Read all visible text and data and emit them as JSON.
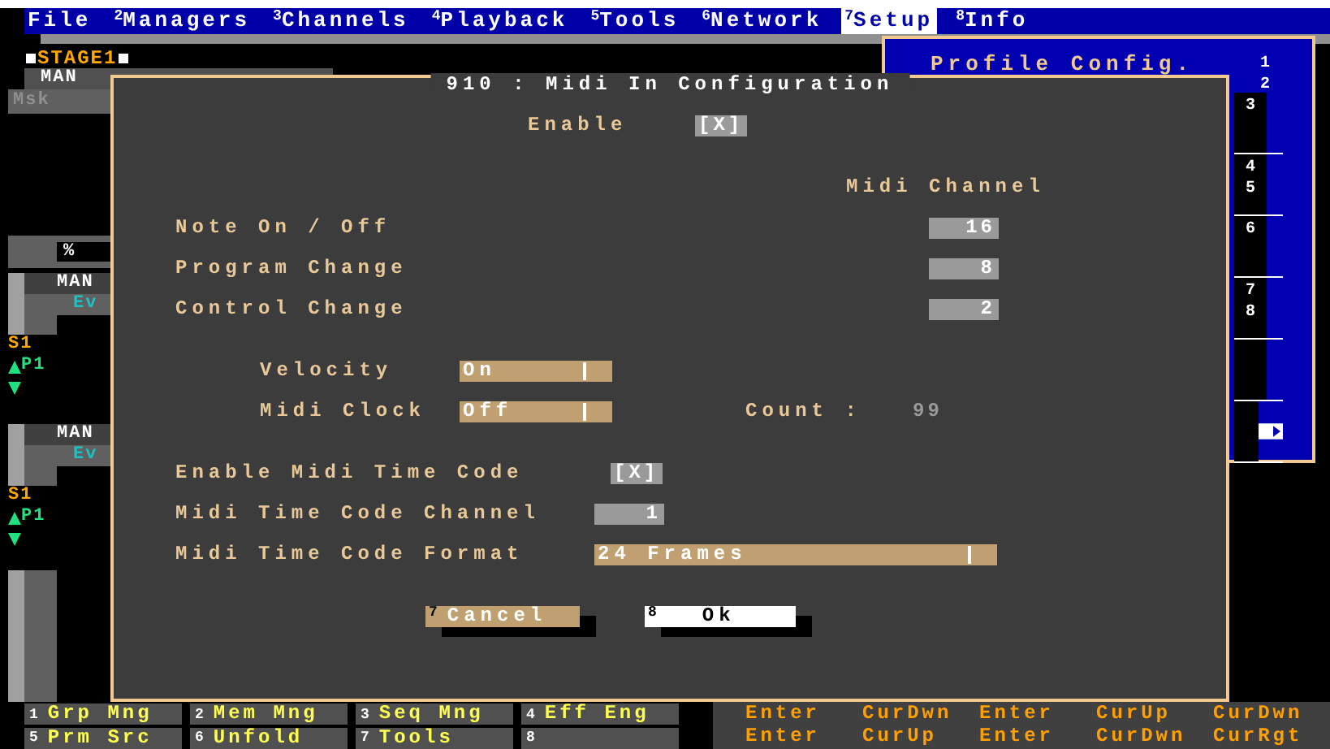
{
  "menu_bar": [
    {
      "label": "File",
      "selected": false
    },
    {
      "number": "2",
      "label": "Managers",
      "selected": false
    },
    {
      "number": "3",
      "label": "Channels",
      "selected": false
    },
    {
      "number": "4",
      "label": "Playback",
      "selected": false
    },
    {
      "number": "5",
      "label": "Tools",
      "selected": false
    },
    {
      "number": "6",
      "label": "Network",
      "selected": false
    },
    {
      "number": "7",
      "label": "Setup",
      "selected": true
    },
    {
      "number": "8",
      "label": "Info",
      "selected": false
    }
  ],
  "stage_panel": {
    "title": "STAGE1",
    "mode": "MAN",
    "mask": "Msk",
    "percent": "%",
    "playbacks": [
      {
        "mode": "MAN",
        "event": "Ev",
        "stage": "S1",
        "preset": "P1"
      },
      {
        "mode": "MAN",
        "event": "Ev",
        "stage": "S1",
        "preset": "P1"
      }
    ]
  },
  "profile_menu": {
    "title": "Profile Config.",
    "header_slots": [
      "1",
      "2"
    ],
    "slot_groups": [
      {
        "kind": "numbers",
        "numbers": [
          "3"
        ]
      },
      {
        "kind": "numbers",
        "numbers": [
          "4",
          "5"
        ]
      },
      {
        "kind": "numbers",
        "numbers": [
          "6"
        ]
      },
      {
        "kind": "numbers",
        "numbers": [
          "7",
          "8"
        ]
      },
      {
        "kind": "blank"
      },
      {
        "kind": "arrow"
      }
    ]
  },
  "dialog": {
    "title": "910 : Midi In Configuration",
    "enable": {
      "label": "Enable",
      "value": "[X]",
      "checked": true
    },
    "channel_header": "Midi Channel",
    "channels": [
      {
        "label": "Note On / Off",
        "value": "16"
      },
      {
        "label": "Program Change",
        "value": "8"
      },
      {
        "label": "Control Change",
        "value": "2"
      }
    ],
    "velocity": {
      "label": "Velocity",
      "value": "On"
    },
    "midi_clock": {
      "label": "Midi Clock",
      "value": "Off"
    },
    "count": {
      "label": "Count :",
      "value": "99"
    },
    "mtc_enable": {
      "label": "Enable Midi Time Code",
      "value": "[X]",
      "checked": true
    },
    "mtc_channel": {
      "label": "Midi Time Code Channel",
      "value": "1"
    },
    "mtc_format": {
      "label": "Midi Time Code Format",
      "value": "24 Frames"
    },
    "buttons": [
      {
        "key": "7",
        "label": "Cancel",
        "focused": false
      },
      {
        "key": "8",
        "label": "Ok",
        "focused": true
      }
    ]
  },
  "function_keys": [
    {
      "number": "1",
      "label": "Grp Mng"
    },
    {
      "number": "2",
      "label": "Mem Mng"
    },
    {
      "number": "3",
      "label": "Seq Mng"
    },
    {
      "number": "4",
      "label": "Eff Eng"
    },
    {
      "number": "5",
      "label": "Prm Src"
    },
    {
      "number": "6",
      "label": "Unfold"
    },
    {
      "number": "7",
      "label": "Tools"
    },
    {
      "number": "8"
    }
  ],
  "cursor_keys": [
    [
      "Enter",
      "CurDwn",
      "Enter",
      "CurUp",
      "CurDwn"
    ],
    [
      "Enter",
      "CurUp",
      "Enter",
      "CurDwn",
      "CurRgt"
    ]
  ]
}
